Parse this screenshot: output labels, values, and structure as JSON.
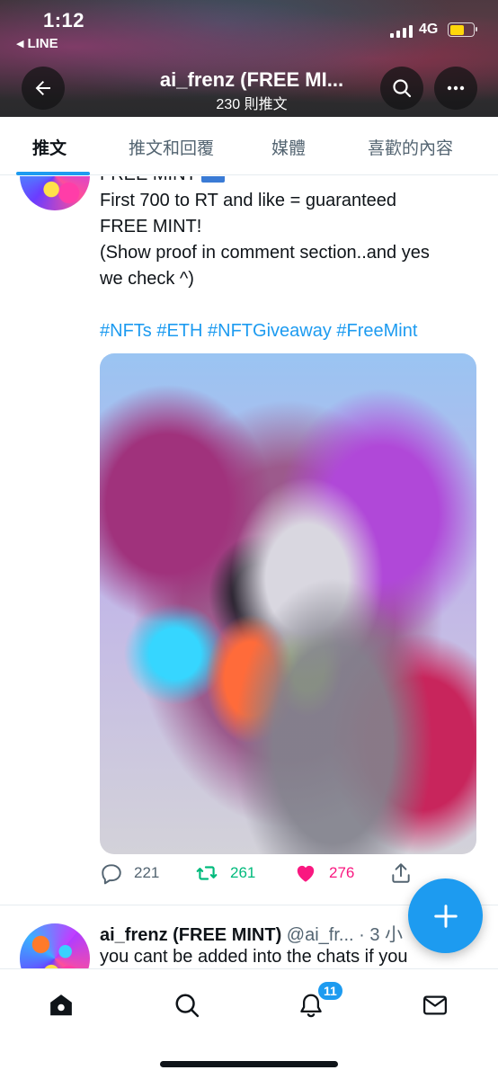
{
  "status_bar": {
    "time": "1:12",
    "back_app": "LINE",
    "network": "4G",
    "back_app_icon": "triangle-left-icon"
  },
  "header": {
    "title": "ai_frenz (FREE MI...",
    "subtitle": "230 則推文",
    "back_icon": "arrow-left-icon",
    "search_icon": "search-icon",
    "more_icon": "more-icon"
  },
  "tabs": [
    {
      "label": "推文",
      "active": true
    },
    {
      "label": "推文和回覆",
      "active": false
    },
    {
      "label": "媒體",
      "active": false
    },
    {
      "label": "喜歡的內容",
      "active": false
    }
  ],
  "tweet1": {
    "partial_line": "FREE MINT",
    "lines": [
      "First 700 to RT and like = guaranteed",
      "FREE MINT!",
      "(Show proof in comment section..and yes",
      "we check ^)"
    ],
    "hashtags": "#NFTs #ETH #NFTGiveaway #FreeMint",
    "reply_count": "221",
    "retweet_count": "261",
    "like_count": "276",
    "liked": true
  },
  "tweet2": {
    "name": "ai_frenz (FREE MINT)",
    "meta": " @ai_fr... · 3 小",
    "text": "you cant be added into the chats if you"
  },
  "fab": {
    "icon": "plus-icon"
  },
  "bottom_nav": {
    "items": [
      {
        "name": "home",
        "icon": "home-icon"
      },
      {
        "name": "search",
        "icon": "search-icon"
      },
      {
        "name": "notifications",
        "icon": "bell-icon"
      },
      {
        "name": "messages",
        "icon": "mail-icon"
      }
    ],
    "notification_badge": "11"
  },
  "colors": {
    "accent": "#1d9bf0",
    "retweet": "#00ba7c",
    "like": "#f91880",
    "text": "#0f1419",
    "muted": "#536471"
  }
}
